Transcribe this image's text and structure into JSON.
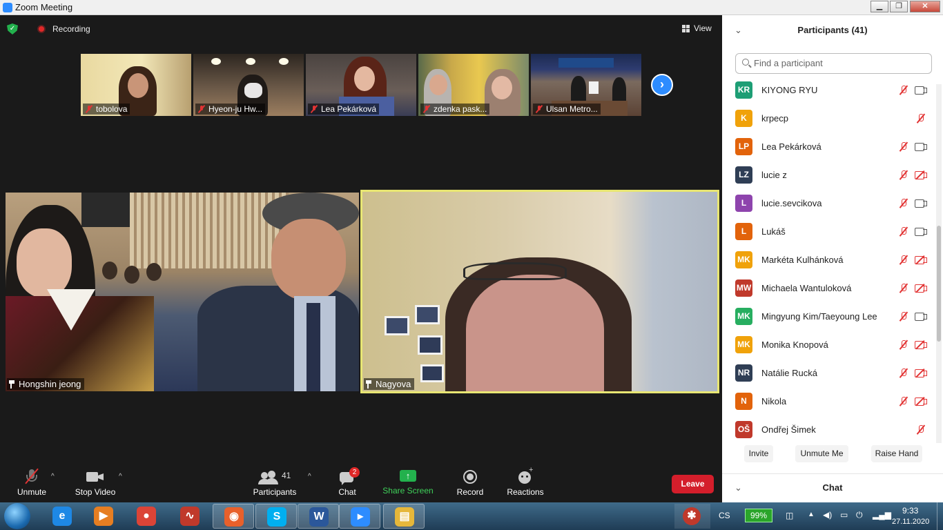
{
  "window": {
    "title": "Zoom Meeting",
    "minimize": "▁",
    "maximize": "❐",
    "close": "✕"
  },
  "meeting": {
    "recording_label": "Recording",
    "view_label": "View",
    "thumbnails": [
      {
        "name": "tobolova"
      },
      {
        "name": "Hyeon-ju Hw..."
      },
      {
        "name": "Lea Pekárková"
      },
      {
        "name": "zdenka pask..."
      },
      {
        "name": "Ulsan Metro..."
      }
    ],
    "next_arrow": "›",
    "tiles": [
      {
        "name": "Hongshin jeong"
      },
      {
        "name": "Nagyova"
      }
    ]
  },
  "toolbar": {
    "unmute_label": "Unmute",
    "stop_video_label": "Stop Video",
    "participants_count": "41",
    "participants_label": "Participants",
    "chat_label": "Chat",
    "chat_badge": "2",
    "share_label": "Share Screen",
    "share_icon": "↑",
    "record_label": "Record",
    "reactions_label": "Reactions",
    "leave_label": "Leave",
    "caret": "^"
  },
  "panel": {
    "title": "Participants (41)",
    "collapse_icon": "⌄",
    "search_placeholder": "Find a participant",
    "participants": [
      {
        "initials": "KR",
        "name": "KIYONG RYU",
        "color": "#1d9e75",
        "mic": "muted",
        "cam": "on"
      },
      {
        "initials": "K",
        "name": "krpecp",
        "color": "#f0a20a",
        "mic": "muted",
        "cam": "none"
      },
      {
        "initials": "LP",
        "name": "Lea Pekárková",
        "color": "#e2630b",
        "mic": "muted",
        "cam": "on"
      },
      {
        "initials": "LZ",
        "name": "lucie z",
        "color": "#2f3e55",
        "mic": "muted",
        "cam": "off"
      },
      {
        "initials": "L",
        "name": "lucie.sevcikova",
        "color": "#8e44ad",
        "mic": "muted",
        "cam": "on"
      },
      {
        "initials": "L",
        "name": "Lukáš",
        "color": "#e2630b",
        "mic": "muted",
        "cam": "on"
      },
      {
        "initials": "MK",
        "name": "Markéta Kulhánková",
        "color": "#f0a20a",
        "mic": "muted",
        "cam": "off"
      },
      {
        "initials": "MW",
        "name": "Michaela Wantuloková",
        "color": "#c0392b",
        "mic": "muted",
        "cam": "off"
      },
      {
        "initials": "MK",
        "name": "Mingyung Kim/Taeyoung Lee",
        "color": "#27ae60",
        "mic": "muted",
        "cam": "on"
      },
      {
        "initials": "MK",
        "name": "Monika Knopová",
        "color": "#f0a20a",
        "mic": "muted",
        "cam": "off"
      },
      {
        "initials": "NR",
        "name": "Natálie Rucká",
        "color": "#2f3e55",
        "mic": "muted",
        "cam": "off"
      },
      {
        "initials": "N",
        "name": "Nikola",
        "color": "#e2630b",
        "mic": "muted",
        "cam": "off"
      },
      {
        "initials": "OŠ",
        "name": "Ondřej Šimek",
        "color": "#c0392b",
        "mic": "muted",
        "cam": "none"
      }
    ],
    "invite_label": "Invite",
    "unmute_me_label": "Unmute Me",
    "raise_hand_label": "Raise Hand",
    "chat_title": "Chat"
  },
  "taskbar": {
    "apps": [
      {
        "name": "internet-explorer",
        "glyph": "e",
        "color": "#1e88e5"
      },
      {
        "name": "media-player",
        "glyph": "▶",
        "color": "#e67e22"
      },
      {
        "name": "chrome",
        "glyph": "●",
        "color": "#db4437"
      },
      {
        "name": "health-app",
        "glyph": "∿",
        "color": "#c0392b"
      },
      {
        "name": "firefox",
        "glyph": "◉",
        "color": "#e8602b"
      },
      {
        "name": "skype",
        "glyph": "S",
        "color": "#00aff0"
      },
      {
        "name": "word",
        "glyph": "W",
        "color": "#2b579a"
      },
      {
        "name": "zoom",
        "glyph": "▸",
        "color": "#2d8cff"
      },
      {
        "name": "file-explorer",
        "glyph": "▤",
        "color": "#e6b73a"
      }
    ],
    "lang": "CS",
    "battery": "99%",
    "time": "9:33",
    "date": "27.11.2020"
  }
}
